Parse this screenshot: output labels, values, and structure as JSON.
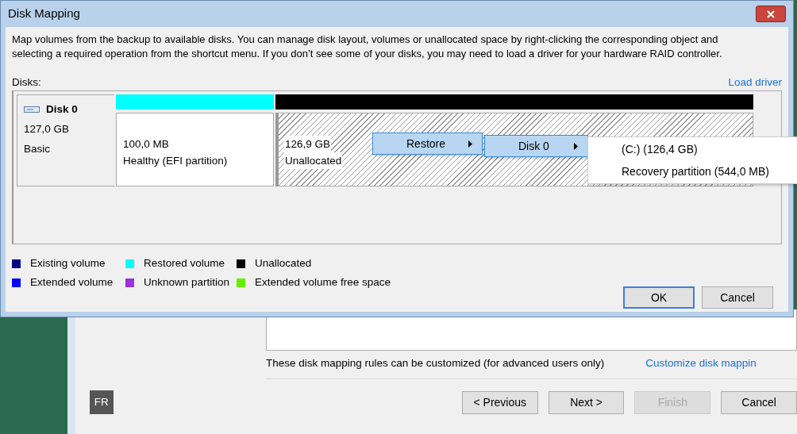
{
  "dialog": {
    "title": "Disk Mapping",
    "description": "Map volumes from the backup to available disks. You can manage disk layout, volumes or unallocated space by right-clicking the corresponding object and selecting a required operation from the shortcut menu. If you don’t see some of your disks, you may need to load a driver for your hardware RAID controller.",
    "disks_label": "Disks:",
    "load_driver": "Load driver",
    "disk": {
      "name": "Disk 0",
      "size": "127,0 GB",
      "type": "Basic"
    },
    "partitions": [
      {
        "kind": "volume",
        "color": "#00ffff",
        "size": "100,0 MB",
        "status": "Healthy (EFI partition)"
      },
      {
        "kind": "unallocated",
        "color": "#000000",
        "size": "126,9 GB",
        "status": "Unallocated"
      }
    ],
    "menus": [
      {
        "items": [
          {
            "label": "Restore",
            "submenu": true,
            "selected": true
          }
        ]
      },
      {
        "items": [
          {
            "label": "Disk 0",
            "submenu": true,
            "selected": true
          }
        ]
      },
      {
        "items": [
          {
            "label": "(C:) (126,4 GB)",
            "submenu": false,
            "selected": false
          },
          {
            "label": "Recovery partition (544,0 MB)",
            "submenu": false,
            "selected": false
          }
        ]
      }
    ],
    "legend": [
      {
        "label": "Existing volume",
        "color": "#000080"
      },
      {
        "label": "Restored volume",
        "color": "#00ffff"
      },
      {
        "label": "Unallocated",
        "color": "#000000"
      },
      {
        "label": "Extended volume",
        "color": "#0000ff"
      },
      {
        "label": "Unknown partition",
        "color": "#9933dd"
      },
      {
        "label": "Extended volume free space",
        "color": "#66ee00"
      }
    ],
    "buttons": [
      {
        "label": "OK",
        "default": true
      },
      {
        "label": "Cancel",
        "default": false
      }
    ]
  },
  "wizard": {
    "rules_text": "These disk mapping rules can be customized (for advanced users only)",
    "customize_link": "Customize disk mappin",
    "language": "FR",
    "buttons": [
      {
        "label": "< Previous",
        "disabled": false
      },
      {
        "label": "Next >",
        "disabled": false
      },
      {
        "label": "Finish",
        "disabled": true
      },
      {
        "label": "Cancel",
        "disabled": false
      }
    ]
  }
}
